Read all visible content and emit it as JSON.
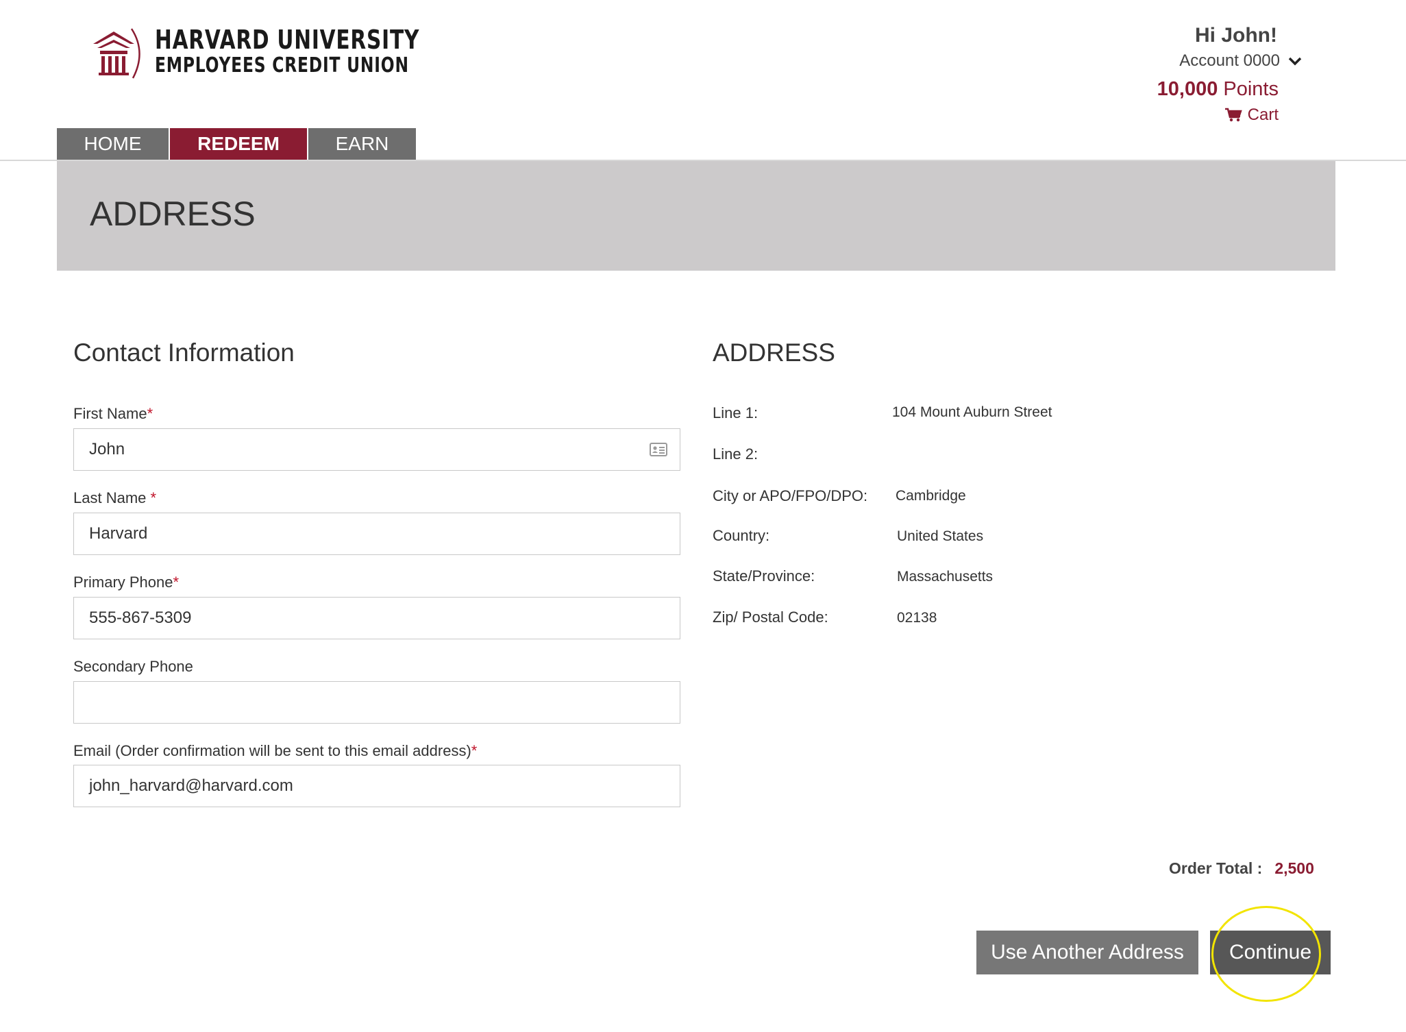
{
  "brand": {
    "line1": "HARVARD UNIVERSITY",
    "line2": "EMPLOYEES CREDIT UNION",
    "color": "#8a1c32"
  },
  "user": {
    "greeting": "Hi John!",
    "account": "Account 0000",
    "points_value": "10,000",
    "points_label": "Points",
    "cart_label": "Cart"
  },
  "nav": {
    "tabs": [
      {
        "label": "HOME",
        "active": false
      },
      {
        "label": "REDEEM",
        "active": true
      },
      {
        "label": "EARN",
        "active": false
      }
    ]
  },
  "page": {
    "title": "ADDRESS"
  },
  "contact": {
    "heading": "Contact Information",
    "required_mark": "*",
    "fields": [
      {
        "label": "First Name",
        "value": "John",
        "required": true
      },
      {
        "label": "Last Name ",
        "value": "Harvard",
        "required": true
      },
      {
        "label": "Primary Phone",
        "value": "555-867-5309",
        "required": true
      },
      {
        "label": "Secondary Phone",
        "value": "",
        "required": false
      },
      {
        "label": "Email (Order confirmation will be sent to this email address)",
        "value": "john_harvard@harvard.com",
        "required": true
      }
    ]
  },
  "address": {
    "heading": "ADDRESS",
    "rows": [
      {
        "label": "Line 1:",
        "value": "104 Mount Auburn Street"
      },
      {
        "label": "Line 2:",
        "value": ""
      },
      {
        "label": "City or APO/FPO/DPO:",
        "value": "Cambridge"
      },
      {
        "label": "Country:",
        "value": "United States"
      },
      {
        "label": "State/Province:",
        "value": "Massachusetts"
      },
      {
        "label": "Zip/ Postal Code:",
        "value": "02138"
      }
    ]
  },
  "order": {
    "total_label": "Order Total :",
    "total_value": "2,500"
  },
  "buttons": {
    "another_address": "Use Another Address",
    "continue": "Continue"
  },
  "icons": [
    "logo-building-icon",
    "chevron-down-icon",
    "cart-icon",
    "contact-card-icon"
  ]
}
